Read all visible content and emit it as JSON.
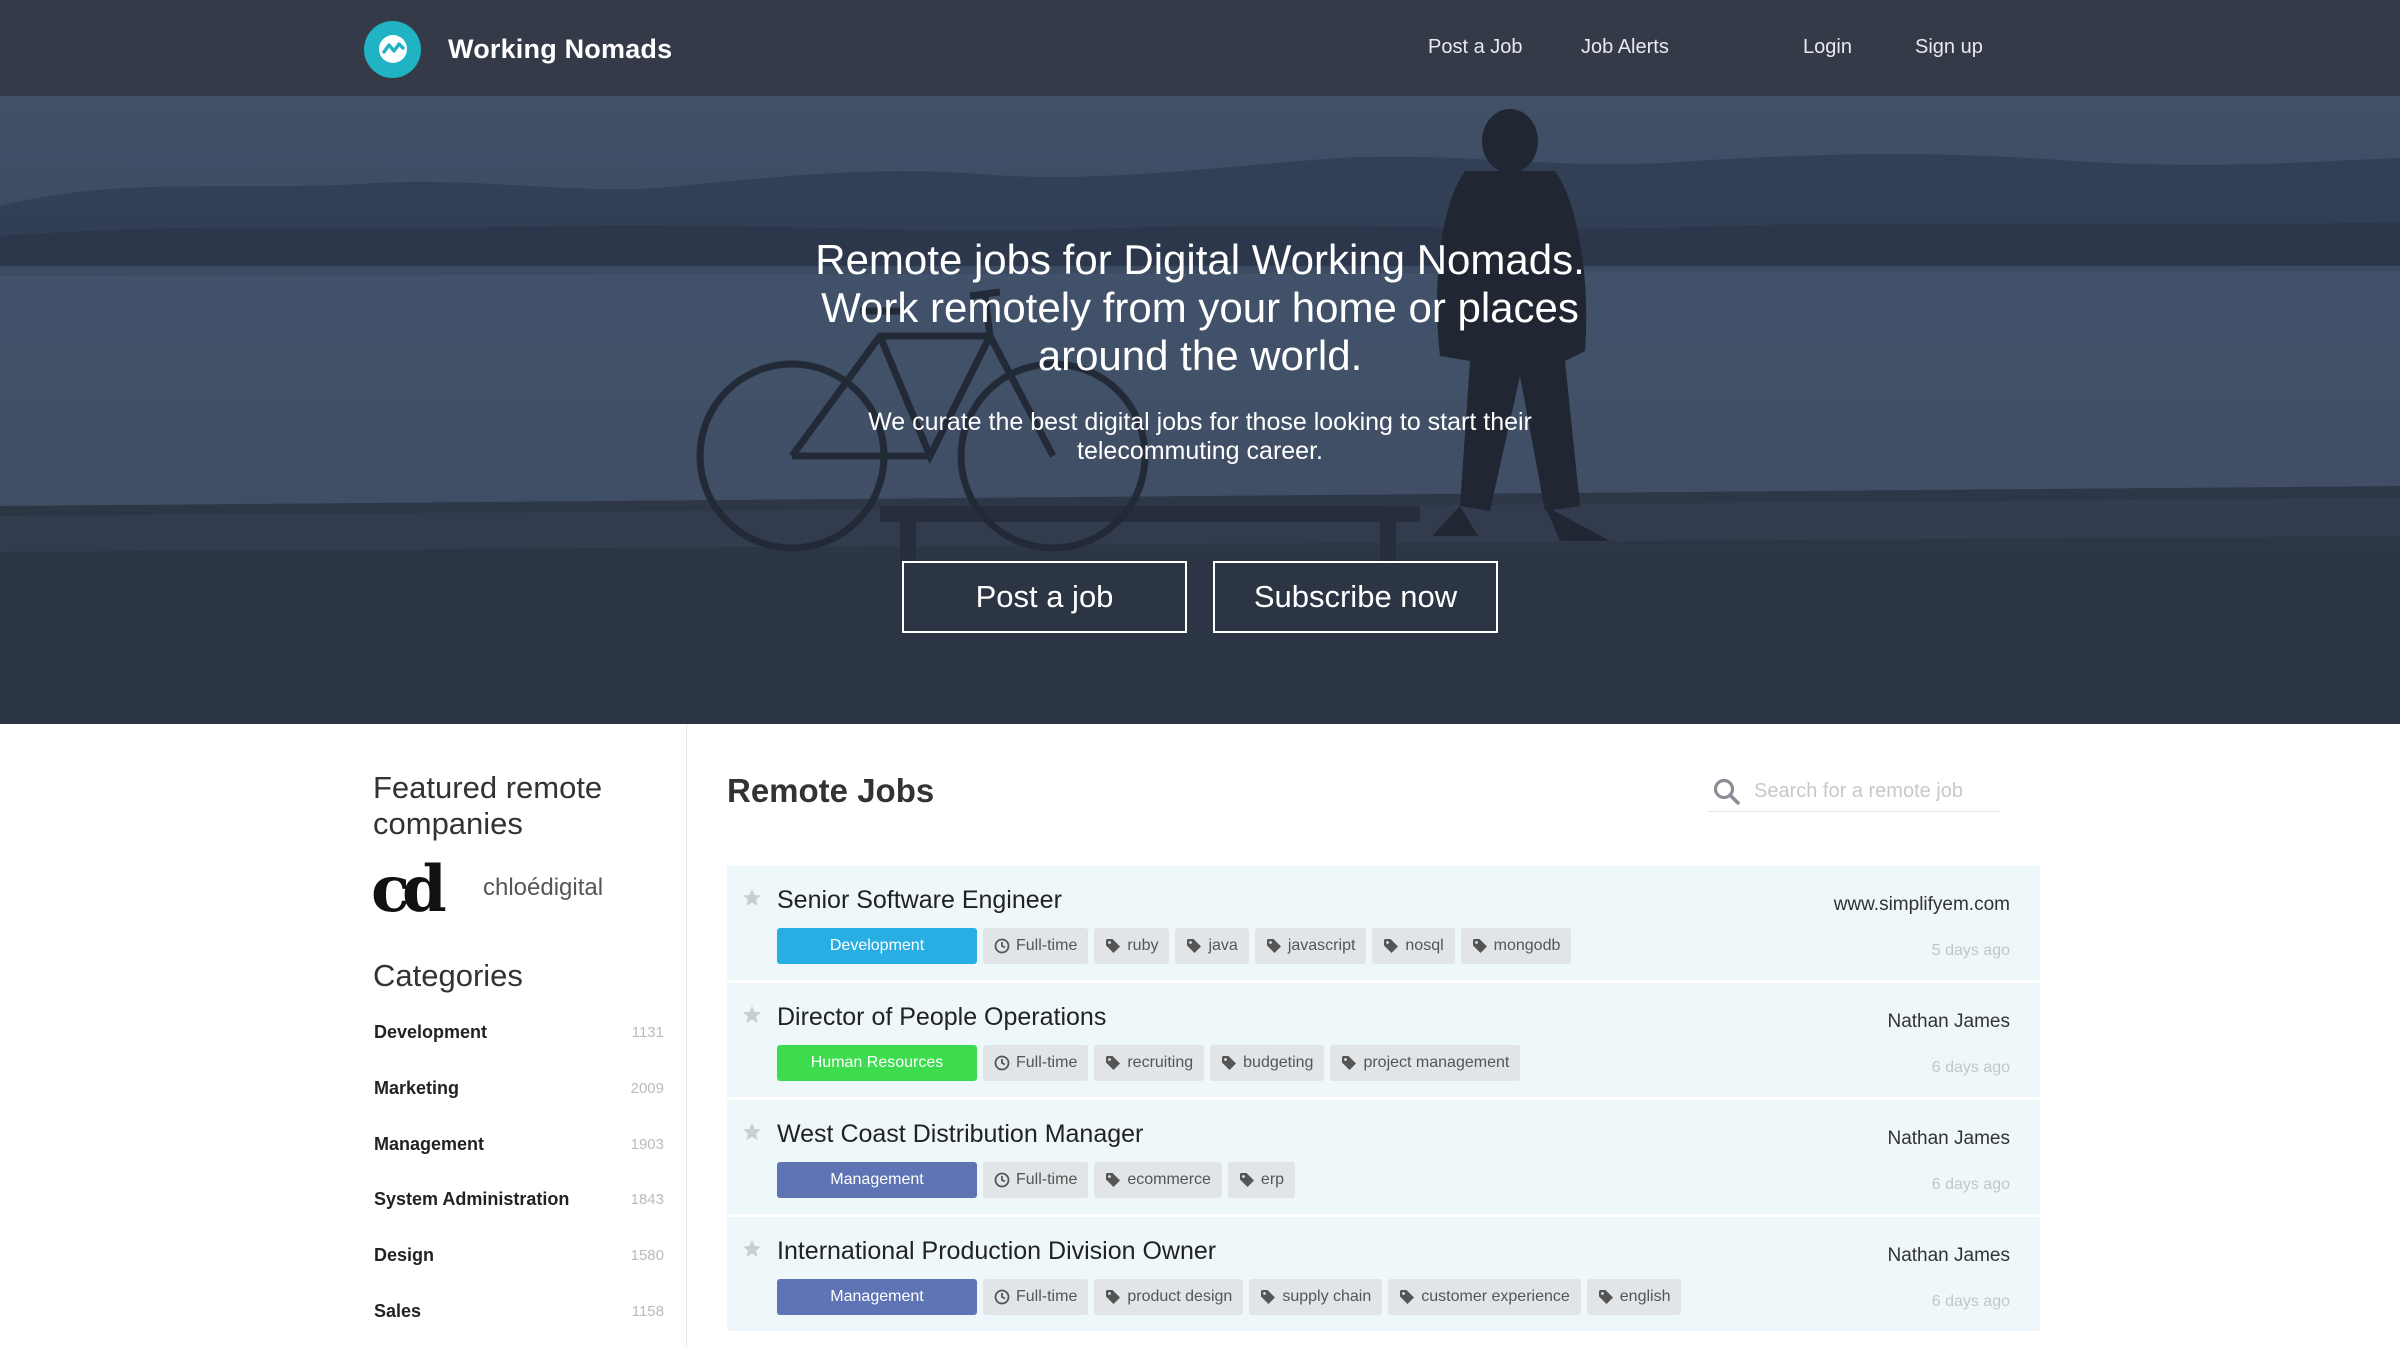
{
  "navbar": {
    "brand": "Working Nomads",
    "links": [
      "Post a Job",
      "Job Alerts",
      "Login",
      "Sign up"
    ]
  },
  "hero": {
    "title_lines": [
      "Remote jobs for Digital Working Nomads.",
      "Work remotely from your home or places",
      "around the world."
    ],
    "subtitle_lines": [
      "We curate the best digital jobs for those looking to start their",
      "telecommuting career."
    ],
    "buttons": [
      "Post a job",
      "Subscribe now"
    ]
  },
  "sidebar": {
    "featured_title": "Featured remote companies",
    "company": {
      "logo_text": "cd",
      "name": "chloédigital"
    },
    "categories_title": "Categories",
    "categories": [
      {
        "label": "Development",
        "count": "1131"
      },
      {
        "label": "Marketing",
        "count": "2009"
      },
      {
        "label": "Management",
        "count": "1903"
      },
      {
        "label": "System Administration",
        "count": "1843"
      },
      {
        "label": "Design",
        "count": "1580"
      },
      {
        "label": "Sales",
        "count": "1158"
      }
    ]
  },
  "main": {
    "title": "Remote Jobs",
    "search": {
      "placeholder": "Search for a remote job"
    },
    "jobs": [
      {
        "title": "Senior Software Engineer",
        "category": "Development",
        "category_color": "#29aee3",
        "type": "Full-time",
        "tags": [
          "ruby",
          "java",
          "javascript",
          "nosql",
          "mongodb"
        ],
        "company": "www.simplifyem.com",
        "posted": "5 days ago"
      },
      {
        "title": "Director of People Operations",
        "category": "Human Resources",
        "category_color": "#3ddc4f",
        "type": "Full-time",
        "tags": [
          "recruiting",
          "budgeting",
          "project management"
        ],
        "company": "Nathan James",
        "posted": "6 days ago"
      },
      {
        "title": "West Coast Distribution Manager",
        "category": "Management",
        "category_color": "#5f74b4",
        "type": "Full-time",
        "tags": [
          "ecommerce",
          "erp"
        ],
        "company": "Nathan James",
        "posted": "6 days ago"
      },
      {
        "title": "International Production Division Owner",
        "category": "Management",
        "category_color": "#5f74b4",
        "type": "Full-time",
        "tags": [
          "product design",
          "supply chain",
          "customer experience",
          "english"
        ],
        "company": "Nathan James",
        "posted": "6 days ago"
      }
    ]
  },
  "colors": {
    "navbar": "#343a48",
    "logo": "#1fb3c3",
    "row_bg": "#eef7f9",
    "tag_bg": "#e2e5e8"
  },
  "icons": [
    "logo-icon",
    "search-icon",
    "star-icon",
    "clock-icon",
    "tag-icon"
  ]
}
